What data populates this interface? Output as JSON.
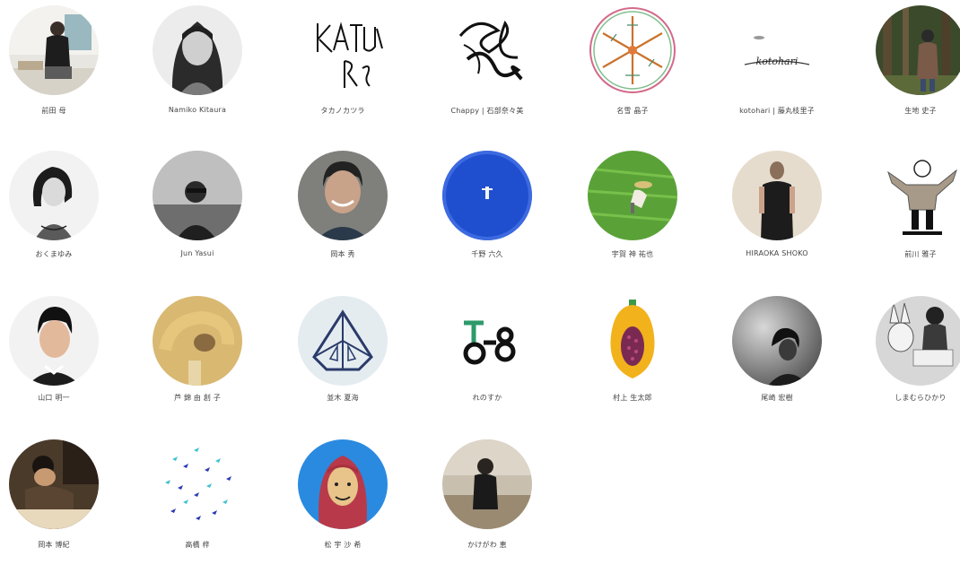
{
  "creators": [
    {
      "name": "前田 母",
      "icon": "portrait-photo-icon"
    },
    {
      "name": "Namiko Kitaura",
      "icon": "portrait-photo-icon"
    },
    {
      "name": "タカノカツラ",
      "icon": "signature-logo-icon"
    },
    {
      "name": "Chappy | 石部奈々美",
      "icon": "scribble-logo-icon"
    },
    {
      "name": "名雪 晶子",
      "icon": "snowflake-illustration-icon"
    },
    {
      "name": "kotohari | 藤丸枝里子",
      "icon": "kotohari-logo-icon"
    },
    {
      "name": "生地 史子",
      "icon": "forest-photo-icon"
    },
    {
      "name": "おくまゆみ",
      "icon": "portrait-illustration-icon"
    },
    {
      "name": "Jun Yasui",
      "icon": "portrait-photo-icon"
    },
    {
      "name": "岡本 秀",
      "icon": "portrait-photo-icon"
    },
    {
      "name": "千野 六久",
      "icon": "blue-paint-icon"
    },
    {
      "name": "宇賀 神 祐也",
      "icon": "rice-field-photo-icon"
    },
    {
      "name": "HIRAOKA SHOKO",
      "icon": "portrait-photo-icon"
    },
    {
      "name": "前川 雅子",
      "icon": "character-illustration-icon"
    },
    {
      "name": "山口 明一",
      "icon": "portrait-illustration-icon"
    },
    {
      "name": "芦 錦 由 創 子",
      "icon": "abstract-photo-icon"
    },
    {
      "name": "並木 夏海",
      "icon": "geometric-logo-icon"
    },
    {
      "name": "れのすか",
      "icon": "bicycle-logo-icon"
    },
    {
      "name": "村上 生太郎",
      "icon": "papaya-illustration-icon"
    },
    {
      "name": "尾崎 宏樹",
      "icon": "portrait-photo-icon"
    },
    {
      "name": "しまむらひかり",
      "icon": "illustration-photo-icon"
    },
    {
      "name": "岡本 博紀",
      "icon": "drawing-photo-icon"
    },
    {
      "name": "高橋 梓",
      "icon": "bird-pattern-icon"
    },
    {
      "name": "松 宇 沙 希",
      "icon": "portrait-illustration-icon"
    },
    {
      "name": "かけがわ 恵",
      "icon": "portrait-photo-icon"
    }
  ]
}
